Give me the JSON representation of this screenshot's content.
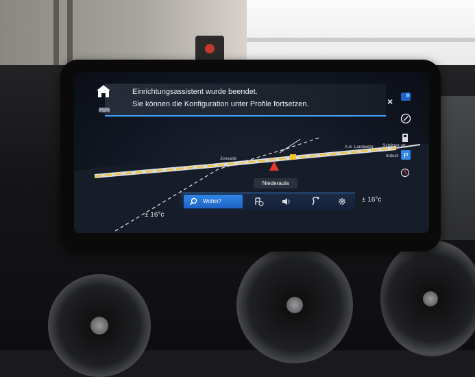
{
  "notification": {
    "line1": "Einrichtungsassistent wurde beendet.",
    "line2": "Sie können die Konfiguration unter Profile fortsetzen."
  },
  "map": {
    "street_left": "Jossastr.",
    "street_right": "A.d. Landwehr",
    "street_far_right": "Schlitzer str.",
    "street_small": "Indust",
    "location": "Niederaula"
  },
  "temperatures": {
    "left": "± 16°c",
    "right": "± 16°c"
  },
  "toolbar": {
    "wohin_label": "Wohin?"
  },
  "colors": {
    "accent_blue": "#2f86e8",
    "route_yellow": "#f2c230",
    "marker_red": "#e03a2a"
  },
  "icons": [
    "home-icon",
    "car-settings-icon",
    "close-icon",
    "satellite-icon",
    "compass-icon",
    "fuel-icon",
    "parking-icon",
    "view-3d-icon",
    "search-icon",
    "poi-icon",
    "volume-icon",
    "route-icon",
    "settings-gear-icon"
  ]
}
